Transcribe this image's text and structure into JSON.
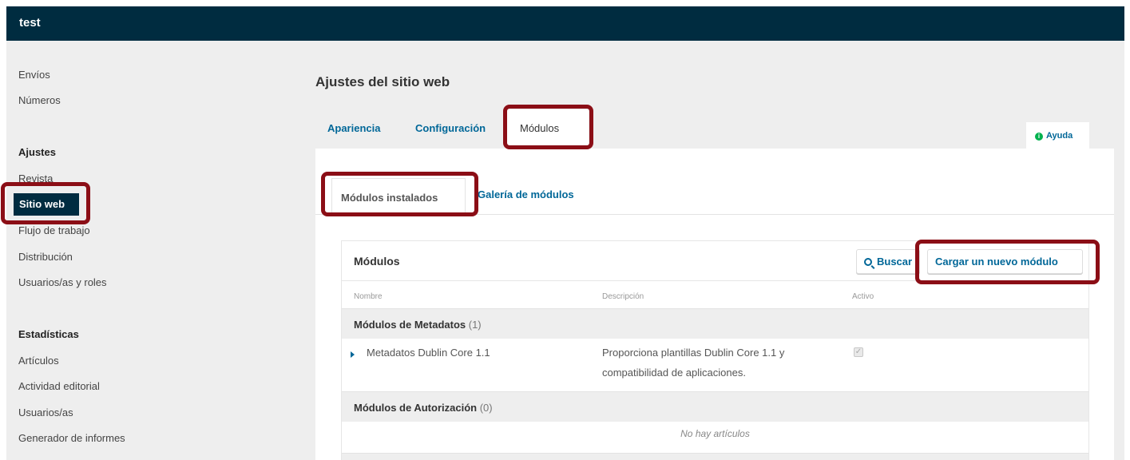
{
  "app": {
    "title": "test"
  },
  "sidebar": {
    "items_top": [
      "Envíos",
      "Números"
    ],
    "settings_heading": "Ajustes",
    "settings_items": [
      "Revista",
      "Sitio web",
      "Flujo de trabajo",
      "Distribución",
      "Usuarios/as y roles"
    ],
    "stats_heading": "Estadísticas",
    "stats_items": [
      "Artículos",
      "Actividad editorial",
      "Usuarios/as",
      "Generador de informes"
    ]
  },
  "page": {
    "title": "Ajustes del sitio web"
  },
  "tabs": [
    "Apariencia",
    "Configuración",
    "Módulos"
  ],
  "help": {
    "label": "Ayuda",
    "icon": "info-icon"
  },
  "subtabs": [
    "Módulos instalados",
    "Galería de módulos"
  ],
  "plugins": {
    "title": "Módulos",
    "search_label": "Buscar",
    "upload_label": "Cargar un nuevo módulo",
    "columns": [
      "Nombre",
      "Descripción",
      "Activo"
    ],
    "groups": [
      {
        "name": "Módulos de Metadatos",
        "count": "(1)",
        "rows": [
          {
            "name": "Metadatos Dublin Core 1.1",
            "desc_line1": "Proporciona plantillas Dublin Core 1.1 y",
            "desc_line2": "compatibilidad de aplicaciones.",
            "active": true
          }
        ]
      },
      {
        "name": "Módulos de Autorización",
        "count": "(0)",
        "empty": "No hay artículos"
      }
    ]
  },
  "colors": {
    "header": "#002c40",
    "link": "#006798",
    "highlight": "#8b0e16",
    "help_icon": "#00b24e"
  }
}
